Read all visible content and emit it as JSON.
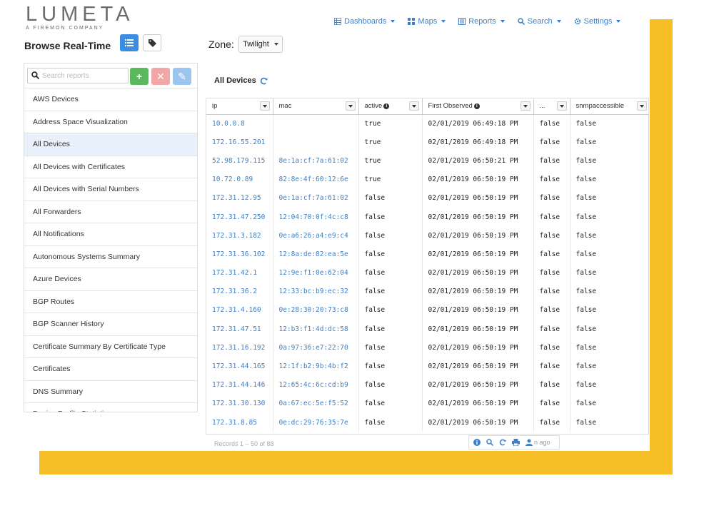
{
  "logo": {
    "word": "LUMETA",
    "sub": "A FIREMON COMPANY"
  },
  "nav": [
    {
      "label": "Dashboards",
      "icon": "dashboard-icon"
    },
    {
      "label": "Maps",
      "icon": "map-grid-icon"
    },
    {
      "label": "Reports",
      "icon": "reports-icon"
    },
    {
      "label": "Search",
      "icon": "search-icon"
    },
    {
      "label": "Settings",
      "icon": "gear-icon"
    }
  ],
  "left_panel": {
    "title": "Browse Real-Time",
    "search_placeholder": "Search reports",
    "reports": [
      "AWS Devices",
      "Address Space Visualization",
      "All Devices",
      "All Devices with Certificates",
      "All Devices with Serial Numbers",
      "All Forwarders",
      "All Notifications",
      "Autonomous Systems Summary",
      "Azure Devices",
      "BGP Routes",
      "BGP Scanner History",
      "Certificate Summary By Certificate Type",
      "Certificates",
      "DNS Summary",
      "Device Profile Statistics"
    ],
    "selected_index": 2
  },
  "zone": {
    "label": "Zone:",
    "value": "Twilight"
  },
  "table": {
    "title": "All Devices",
    "columns": [
      "ip",
      "mac",
      "active",
      "First Observed",
      "...",
      "snmpaccessible"
    ],
    "rows": [
      [
        "10.0.0.8",
        "",
        "true",
        "02/01/2019 06:49:18 PM",
        "false",
        "false"
      ],
      [
        "172.16.55.201",
        "",
        "true",
        "02/01/2019 06:49:18 PM",
        "false",
        "false"
      ],
      [
        "52.98.179.115",
        "8e:1a:cf:7a:61:02",
        "true",
        "02/01/2019 06:50:21 PM",
        "false",
        "false"
      ],
      [
        "10.72.0.89",
        "82:8e:4f:60:12:6e",
        "true",
        "02/01/2019 06:50:19 PM",
        "false",
        "false"
      ],
      [
        "172.31.12.95",
        "0e:1a:cf:7a:61:02",
        "false",
        "02/01/2019 06:50:19 PM",
        "false",
        "false"
      ],
      [
        "172.31.47.250",
        "12:04:70:0f:4c:c8",
        "false",
        "02/01/2019 06:50:19 PM",
        "false",
        "false"
      ],
      [
        "172.31.3.182",
        "0e:a6:26:a4:e9:c4",
        "false",
        "02/01/2019 06:50:19 PM",
        "false",
        "false"
      ],
      [
        "172.31.36.102",
        "12:8a:de:82:ea:5e",
        "false",
        "02/01/2019 06:50:19 PM",
        "false",
        "false"
      ],
      [
        "172.31.42.1",
        "12:9e:f1:0e:62:04",
        "false",
        "02/01/2019 06:50:19 PM",
        "false",
        "false"
      ],
      [
        "172.31.36.2",
        "12:33:bc:b9:ec:32",
        "false",
        "02/01/2019 06:50:19 PM",
        "false",
        "false"
      ],
      [
        "172.31.4.160",
        "0e:28:30:20:73:c8",
        "false",
        "02/01/2019 06:50:19 PM",
        "false",
        "false"
      ],
      [
        "172.31.47.51",
        "12:b3:f1:4d:dc:58",
        "false",
        "02/01/2019 06:50:19 PM",
        "false",
        "false"
      ],
      [
        "172.31.16.192",
        "0a:97:36:e7:22:70",
        "false",
        "02/01/2019 06:50:19 PM",
        "false",
        "false"
      ],
      [
        "172.31.44.165",
        "12:1f:b2:9b:4b:f2",
        "false",
        "02/01/2019 06:50:19 PM",
        "false",
        "false"
      ],
      [
        "172.31.44.146",
        "12:65:4c:6c:cd:b9",
        "false",
        "02/01/2019 06:50:19 PM",
        "false",
        "false"
      ],
      [
        "172.31.30.130",
        "0a:67:ec:5e:f5:52",
        "false",
        "02/01/2019 06:50:19 PM",
        "false",
        "false"
      ],
      [
        "172.31.8.85",
        "0e:dc:29:76:35:7e",
        "false",
        "02/01/2019 06:50:19 PM",
        "false",
        "false"
      ]
    ],
    "records_text": "Records 1 – 50 of 88",
    "updated_text": "n ago"
  },
  "colors": {
    "accent_yellow": "#f7bf27",
    "link_blue": "#3d7fc8",
    "add_green": "#5cb85c"
  }
}
